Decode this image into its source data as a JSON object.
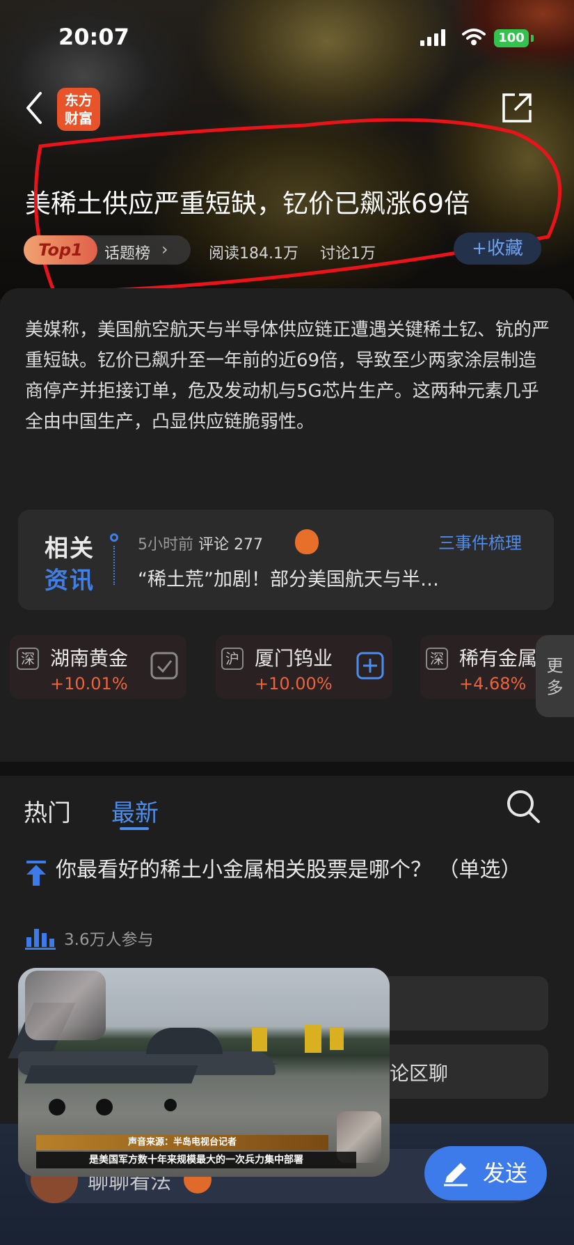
{
  "status": {
    "time": "20:07",
    "battery": "100"
  },
  "header": {
    "logo_line1": "东方",
    "logo_line2": "财富"
  },
  "topic": {
    "title": "美稀土供应严重短缺，钇价已飙涨69倍",
    "badge": "Top1",
    "ranking": "话题榜",
    "reads": "阅读184.1万",
    "discussions": "讨论1万",
    "collect_label": "+收藏"
  },
  "description": "美媒称，美国航空航天与半导体供应链正遭遇关键稀土钇、钪的严重短缺。钇价已飙升至一年前的近69倍，导致至少两家涂层制造商停产并拒接订单，危及发动机与5G芯片生产。这两种元素几乎全由中国生产，凸显供应链脆弱性。",
  "related_news": {
    "logo_line1": "相关",
    "logo_line2": "资讯",
    "time": "5小时前",
    "comment_label": "评论",
    "comment_count": "277",
    "events_label": "三事件梳理",
    "headline": "“稀土荒”加剧！部分美国航天与半…"
  },
  "stocks": [
    {
      "market": "深",
      "name": "湖南黄金",
      "change": "+10.01%",
      "state": "added"
    },
    {
      "market": "沪",
      "name": "厦门钨业",
      "change": "+10.00%",
      "state": "add"
    },
    {
      "market": "深",
      "name": "稀有金属",
      "change": "+4.68%",
      "state": "none"
    }
  ],
  "more_label": "更多",
  "tabs": {
    "hot": "热门",
    "latest": "最新"
  },
  "poll": {
    "question": "你最看好的稀土小金属相关股票是哪个？ （单选）",
    "participants": "3.6万人参与",
    "option2_visible": "论区聊"
  },
  "video": {
    "caption1": "声音来源：半岛电视台记者",
    "caption2": "是美国军方数十年来规模最大的一次兵力集中部署"
  },
  "bottom": {
    "input_text": "聊聊看法",
    "send_label": "发送"
  },
  "colors": {
    "accent": "#3d7bea",
    "up": "#f0623a",
    "logo": "#e8532a"
  }
}
